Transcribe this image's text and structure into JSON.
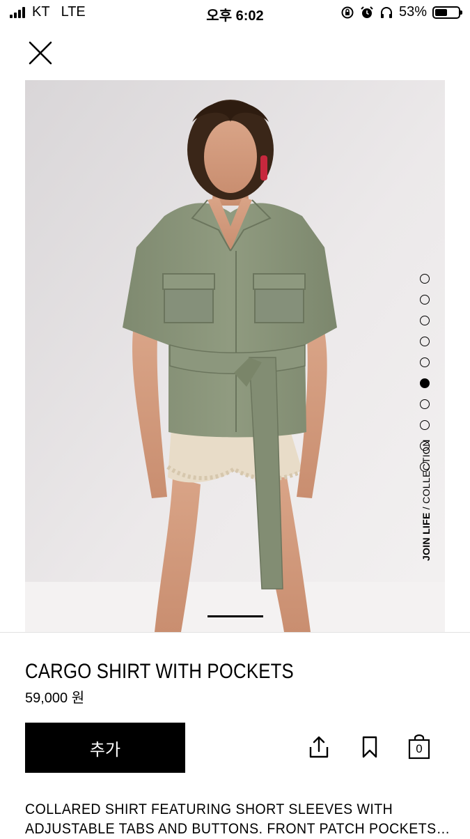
{
  "status": {
    "carrier": "KT",
    "network": "LTE",
    "time": "오후 6:02",
    "battery_percent": "53%",
    "battery_level": 0.53
  },
  "product": {
    "name": "CARGO SHIRT WITH POCKETS",
    "price": "59,000 원",
    "add_label": "추가",
    "bag_count": "0",
    "join_life_strong": "JOIN LIFE",
    "join_life_rest": " / COLLECTION",
    "description_lines": [
      "COLLARED SHIRT FEATURING SHORT SLEEVES WITH",
      "ADJUSTABLE TABS AND BUTTONS. FRONT PATCH POCKETS…"
    ],
    "gallery_total": 10,
    "gallery_active": 6
  },
  "icons": {
    "close": "close-icon",
    "share": "share-icon",
    "bookmark": "bookmark-icon",
    "bag": "shopping-bag-icon"
  },
  "colors": {
    "background": "#ffffff",
    "button": "#000000",
    "button_text": "#ffffff",
    "photo_bg": "#e9e7e8",
    "shirt": "#8a957a"
  }
}
